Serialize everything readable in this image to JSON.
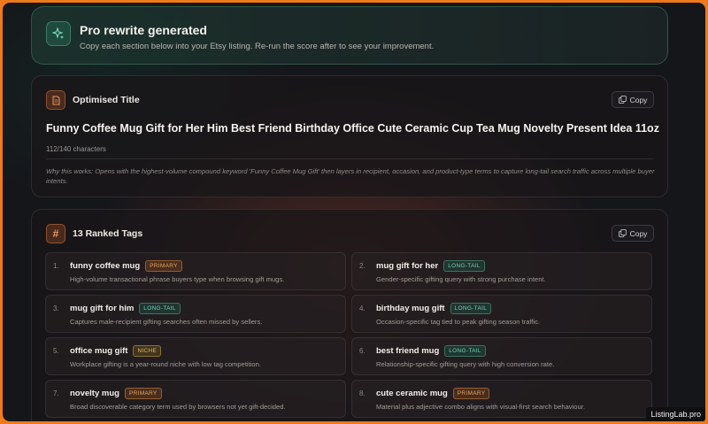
{
  "banner": {
    "icon": "sparkles-icon",
    "title": "Pro rewrite generated",
    "subtitle": "Copy each section below into your Etsy listing. Re-run the score after to see your improvement."
  },
  "title_card": {
    "icon": "document-icon",
    "heading": "Optimised Title",
    "copy_label": "Copy",
    "title": "Funny Coffee Mug Gift for Her Him Best Friend Birthday Office Cute Ceramic Cup Tea Mug Novelty Present Idea 11oz",
    "char_count": "112/140 characters",
    "why": "Why this works: Opens with the highest-volume compound keyword 'Funny Coffee Mug Gift' then layers in recipient, occasion, and product-type terms to capture long-tail search traffic across multiple buyer intents."
  },
  "tags_card": {
    "icon": "hash-icon",
    "heading": "13 Ranked Tags",
    "copy_label": "Copy",
    "tags": [
      {
        "num": "1.",
        "name": "funny coffee mug",
        "badge": "PRIMARY",
        "type": "primary",
        "desc": "High-volume transactional phrase buyers type when browsing gift mugs."
      },
      {
        "num": "2.",
        "name": "mug gift for her",
        "badge": "LONG-TAIL",
        "type": "longtail",
        "desc": "Gender-specific gifting query with strong purchase intent."
      },
      {
        "num": "3.",
        "name": "mug gift for him",
        "badge": "LONG-TAIL",
        "type": "longtail",
        "desc": "Captures male-recipient gifting searches often missed by sellers."
      },
      {
        "num": "4.",
        "name": "birthday mug gift",
        "badge": "LONG-TAIL",
        "type": "longtail",
        "desc": "Occasion-specific tag tied to peak gifting season traffic."
      },
      {
        "num": "5.",
        "name": "office mug gift",
        "badge": "NICHE",
        "type": "niche",
        "desc": "Workplace gifting is a year-round niche with low tag competition."
      },
      {
        "num": "6.",
        "name": "best friend mug",
        "badge": "LONG-TAIL",
        "type": "longtail",
        "desc": "Relationship-specific gifting query with high conversion rate."
      },
      {
        "num": "7.",
        "name": "novelty mug",
        "badge": "PRIMARY",
        "type": "primary",
        "desc": "Broad discoverable category term used by browsers not yet gift-decided."
      },
      {
        "num": "8.",
        "name": "cute ceramic mug",
        "badge": "PRIMARY",
        "type": "primary",
        "desc": "Material plus adjective combo aligns with visual-first search behaviour."
      }
    ]
  },
  "watermark": "ListingLab.pro",
  "colors": {
    "accent_orange": "#f07a1a",
    "accent_green": "#6fd0b2",
    "background": "#15161a"
  }
}
